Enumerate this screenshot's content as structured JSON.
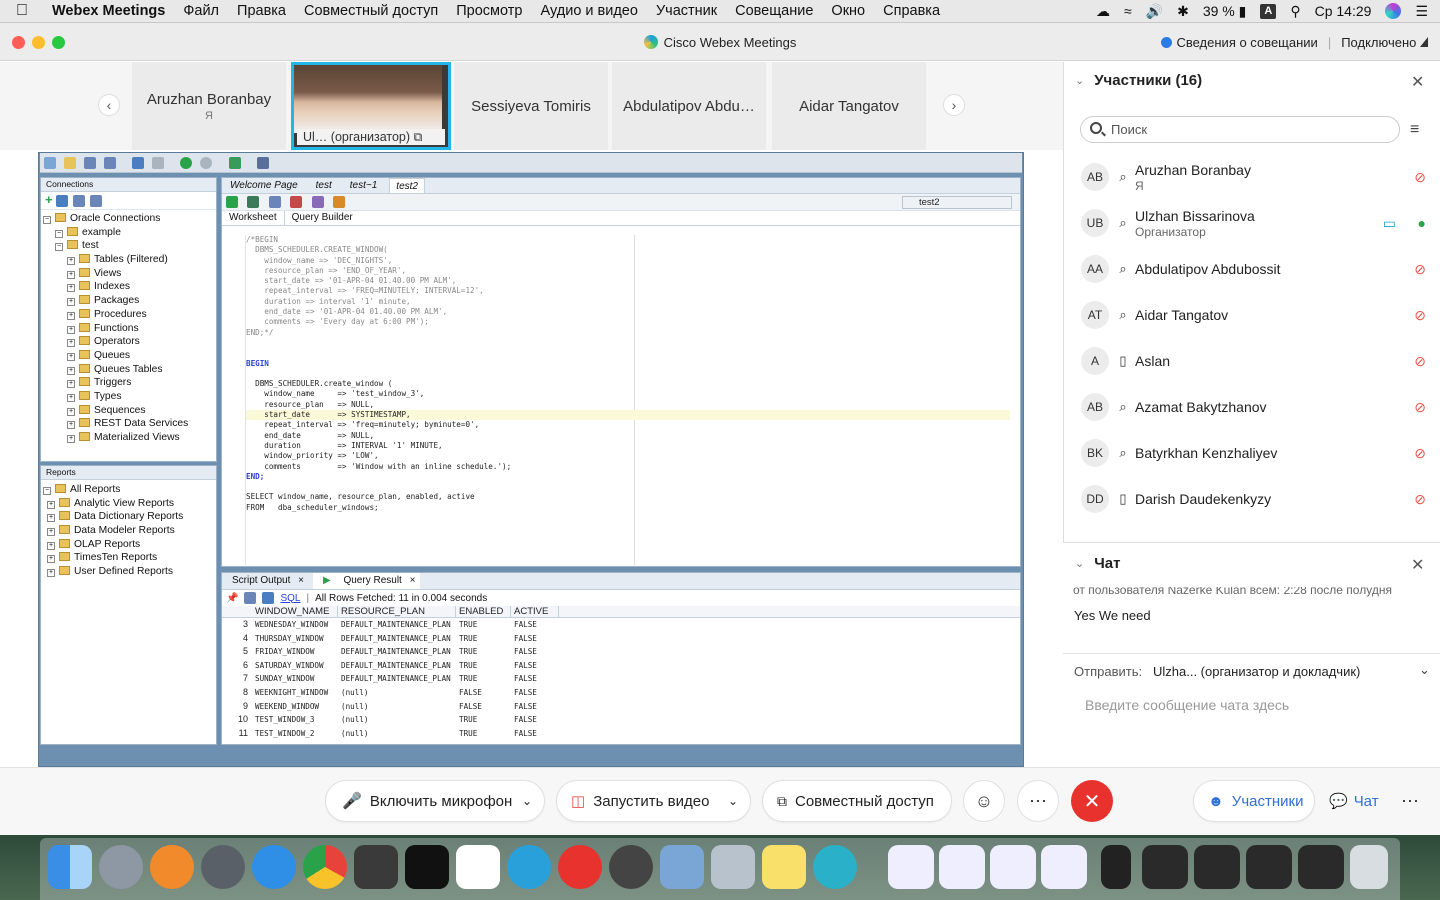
{
  "menubar": {
    "app": "Webex Meetings",
    "items": [
      "Файл",
      "Правка",
      "Совместный доступ",
      "Просмотр",
      "Аудио и видео",
      "Участник",
      "Совещание",
      "Окно",
      "Справка"
    ],
    "battery": "39 %",
    "input": "A",
    "clock": "Ср 14:29"
  },
  "window": {
    "title": "Cisco Webex Meetings",
    "info": "Сведения о совещании",
    "status": "Подключено"
  },
  "strip": {
    "tiles": [
      {
        "name": "Aruzhan Boranbay",
        "sub": "Я"
      },
      {
        "name": "Ul…   (организатор)",
        "sub": ""
      },
      {
        "name": "Sessiyeva Tomiris",
        "sub": ""
      },
      {
        "name": "Abdulatipov Abdu…",
        "sub": ""
      },
      {
        "name": "Aidar Tangatov",
        "sub": ""
      }
    ]
  },
  "sqldev": {
    "connections_title": "Connections",
    "tree": [
      {
        "label": "Oracle Connections",
        "level": 0
      },
      {
        "label": "example",
        "level": 1
      },
      {
        "label": "test",
        "level": 1
      },
      {
        "label": "Tables (Filtered)",
        "level": 2
      },
      {
        "label": "Views",
        "level": 2
      },
      {
        "label": "Indexes",
        "level": 2
      },
      {
        "label": "Packages",
        "level": 2
      },
      {
        "label": "Procedures",
        "level": 2
      },
      {
        "label": "Functions",
        "level": 2
      },
      {
        "label": "Operators",
        "level": 2
      },
      {
        "label": "Queues",
        "level": 2
      },
      {
        "label": "Queues Tables",
        "level": 2
      },
      {
        "label": "Triggers",
        "level": 2
      },
      {
        "label": "Types",
        "level": 2
      },
      {
        "label": "Sequences",
        "level": 2
      },
      {
        "label": "REST Data Services",
        "level": 2
      },
      {
        "label": "Materialized Views",
        "level": 2
      }
    ],
    "reports_title": "Reports",
    "reports": [
      "All Reports",
      "Analytic View Reports",
      "Data Dictionary Reports",
      "Data Modeler Reports",
      "OLAP Reports",
      "TimesTen Reports",
      "User Defined Reports"
    ],
    "tabs": [
      "Welcome Page",
      "test",
      "test~1",
      "test2"
    ],
    "connection_select": "test2",
    "worksheet_tabs": [
      "Worksheet",
      "Query Builder"
    ],
    "code": [
      {
        "t": "/*BEGIN",
        "c": "cm"
      },
      {
        "t": "  DBMS_SCHEDULER.CREATE_WINDOW(",
        "c": "cm"
      },
      {
        "t": "    window_name => 'DEC_NIGHTS',",
        "c": "cm"
      },
      {
        "t": "    resource_plan => 'END_OF_YEAR',",
        "c": "cm"
      },
      {
        "t": "    start_date => '01-APR-04 01.40.00 PM ALM',",
        "c": "cm"
      },
      {
        "t": "    repeat_interval => 'FREQ=MINUTELY; INTERVAL=12',",
        "c": "cm"
      },
      {
        "t": "    duration => interval '1' minute,",
        "c": "cm"
      },
      {
        "t": "    end_date => '01-APR-04 01.40.00 PM ALM',",
        "c": "cm"
      },
      {
        "t": "    comments => 'Every day at 6:00 PM');",
        "c": "cm"
      },
      {
        "t": "END;*/",
        "c": "cm"
      },
      {
        "t": "",
        "c": ""
      },
      {
        "t": "",
        "c": ""
      },
      {
        "t": "BEGIN",
        "c": "kw"
      },
      {
        "t": "",
        "c": ""
      },
      {
        "t": "  DBMS_SCHEDULER.create_window (",
        "c": ""
      },
      {
        "t": "    window_name     => 'test_window_3',",
        "c": ""
      },
      {
        "t": "    resource_plan   => NULL,",
        "c": ""
      },
      {
        "t": "    start_date      => SYSTIMESTAMP,",
        "c": "hl"
      },
      {
        "t": "    repeat_interval => 'freq=minutely; byminute=0',",
        "c": ""
      },
      {
        "t": "    end_date        => NULL,",
        "c": ""
      },
      {
        "t": "    duration        => INTERVAL '1' MINUTE,",
        "c": ""
      },
      {
        "t": "    window_priority => 'LOW',",
        "c": ""
      },
      {
        "t": "    comments        => 'Window with an inline schedule.');",
        "c": ""
      },
      {
        "t": "END;",
        "c": "kw"
      },
      {
        "t": "",
        "c": ""
      },
      {
        "t": "SELECT window_name, resource_plan, enabled, active",
        "c": ""
      },
      {
        "t": "FROM   dba_scheduler_windows;",
        "c": ""
      }
    ],
    "result_tabs": [
      "Script Output",
      "Query Result"
    ],
    "result_sql": "SQL",
    "result_status": "All Rows Fetched: 11 in 0.004 seconds",
    "columns": [
      "WINDOW_NAME",
      "RESOURCE_PLAN",
      "ENABLED",
      "ACTIVE"
    ],
    "rows": [
      [
        "3",
        "WEDNESDAY_WINDOW",
        "DEFAULT_MAINTENANCE_PLAN",
        "TRUE",
        "FALSE"
      ],
      [
        "4",
        "THURSDAY_WINDOW",
        "DEFAULT_MAINTENANCE_PLAN",
        "TRUE",
        "FALSE"
      ],
      [
        "5",
        "FRIDAY_WINDOW",
        "DEFAULT_MAINTENANCE_PLAN",
        "TRUE",
        "FALSE"
      ],
      [
        "6",
        "SATURDAY_WINDOW",
        "DEFAULT_MAINTENANCE_PLAN",
        "TRUE",
        "FALSE"
      ],
      [
        "7",
        "SUNDAY_WINDOW",
        "DEFAULT_MAINTENANCE_PLAN",
        "TRUE",
        "FALSE"
      ],
      [
        "8",
        "WEEKNIGHT_WINDOW",
        "(null)",
        "FALSE",
        "FALSE"
      ],
      [
        "9",
        "WEEKEND_WINDOW",
        "(null)",
        "FALSE",
        "FALSE"
      ],
      [
        "10",
        "TEST_WINDOW_3",
        "(null)",
        "TRUE",
        "FALSE"
      ],
      [
        "11",
        "TEST_WINDOW_2",
        "(null)",
        "TRUE",
        "FALSE"
      ]
    ]
  },
  "participants": {
    "title": "Участники (16)",
    "search_placeholder": "Поиск",
    "list": [
      {
        "initials": "AB",
        "name": "Aruzhan Boranbay",
        "role": "Я",
        "device": "headset-icon",
        "muted": true
      },
      {
        "initials": "UB",
        "name": "Ulzhan Bissarinova",
        "role": "Организатор",
        "device": "headset-icon",
        "muted": false
      },
      {
        "initials": "AA",
        "name": "Abdulatipov Abdubossit",
        "role": "",
        "device": "headset-icon",
        "muted": true
      },
      {
        "initials": "AT",
        "name": "Aidar Tangatov",
        "role": "",
        "device": "headset-icon",
        "muted": true
      },
      {
        "initials": "A",
        "name": "Aslan",
        "role": "",
        "device": "phone-icon",
        "muted": true
      },
      {
        "initials": "AB",
        "name": "Azamat Bakytzhanov",
        "role": "",
        "device": "headset-icon",
        "muted": true
      },
      {
        "initials": "BK",
        "name": "Batyrkhan Kenzhaliyev",
        "role": "",
        "device": "headset-icon",
        "muted": true
      },
      {
        "initials": "DD",
        "name": "Darish Daudekenkyzy",
        "role": "",
        "device": "phone-icon",
        "muted": true
      }
    ]
  },
  "chat": {
    "title": "Чат",
    "prev_line": "от пользователя Nazerke Kulan всем:    2:28  после полудня",
    "message": "Yes We need",
    "send_label": "Отправить:",
    "send_to": "Ulzha... (организатор и докладчик)",
    "input_placeholder": "Введите сообщение чата здесь"
  },
  "controls": {
    "mic": "Включить микрофон",
    "video": "Запустить видео",
    "share": "Совместный доступ",
    "participants": "Участники",
    "chat": "Чат"
  },
  "colors": {
    "accent": "#23b5e8",
    "end_call": "#e8322d",
    "mute": "#e8524a",
    "link": "#2f6fd8"
  }
}
